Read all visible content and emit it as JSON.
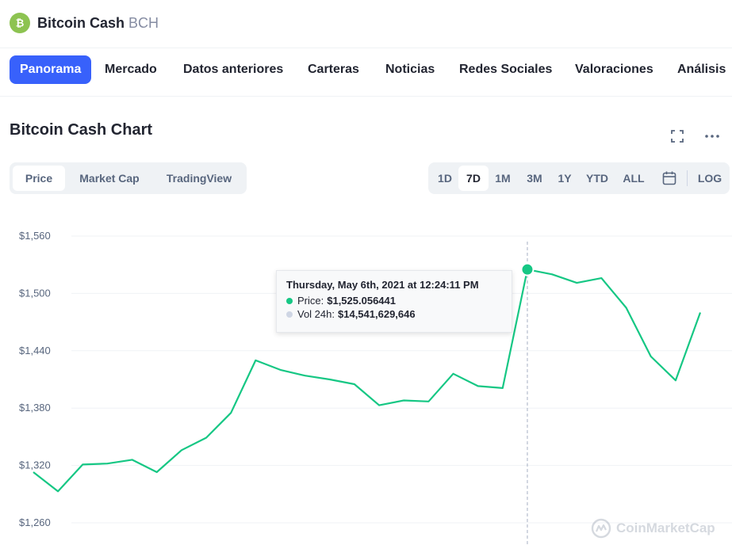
{
  "header": {
    "coin_name": "Bitcoin Cash",
    "coin_symbol": "BCH",
    "logo_color": "#8dc351"
  },
  "nav": {
    "items": [
      {
        "label": "Panorama",
        "active": true
      },
      {
        "label": "Mercado"
      },
      {
        "label": "Datos anteriores"
      },
      {
        "label": "Carteras"
      },
      {
        "label": "Noticias"
      },
      {
        "label": "Redes Sociales"
      },
      {
        "label": "Valoraciones"
      },
      {
        "label": "Análisis"
      }
    ],
    "accent_color": "#3861fb"
  },
  "chart_section": {
    "title": "Bitcoin Cash Chart",
    "icons": [
      "expand-icon",
      "more-icon"
    ]
  },
  "chart_tabs": [
    {
      "label": "Price",
      "active": true
    },
    {
      "label": "Market Cap"
    },
    {
      "label": "TradingView"
    }
  ],
  "range_buttons": [
    {
      "label": "1D"
    },
    {
      "label": "7D",
      "active": true
    },
    {
      "label": "1M"
    },
    {
      "label": "3M"
    },
    {
      "label": "1Y"
    },
    {
      "label": "YTD"
    },
    {
      "label": "ALL"
    },
    {
      "label": "LOG"
    }
  ],
  "tooltip": {
    "date": "Thursday, May 6th, 2021 at 12:24:11 PM",
    "price_label": "Price:",
    "price_value": "$1,525.056441",
    "vol_label": "Vol 24h:",
    "vol_value": "$14,541,629,646"
  },
  "watermark": "CoinMarketCap",
  "chart_data": {
    "type": "line",
    "title": "",
    "xlabel": "",
    "ylabel": "",
    "y_ticks": [
      "$1,560",
      "$1,500",
      "$1,440",
      "$1,380",
      "$1,320",
      "$1,260"
    ],
    "ylim": [
      1260,
      1560
    ],
    "line_color": "#16c784",
    "grid": true,
    "series": [
      {
        "values": [
          1313,
          1293,
          1321,
          1322,
          1326,
          1313,
          1336,
          1349,
          1375,
          1430,
          1420,
          1414,
          1410,
          1405,
          1383,
          1388,
          1387,
          1416,
          1403,
          1401,
          1525,
          1520,
          1511,
          1516,
          1485,
          1434,
          1409,
          1480
        ]
      }
    ],
    "highlight_index": 20,
    "highlight_value": 1525.056441
  }
}
